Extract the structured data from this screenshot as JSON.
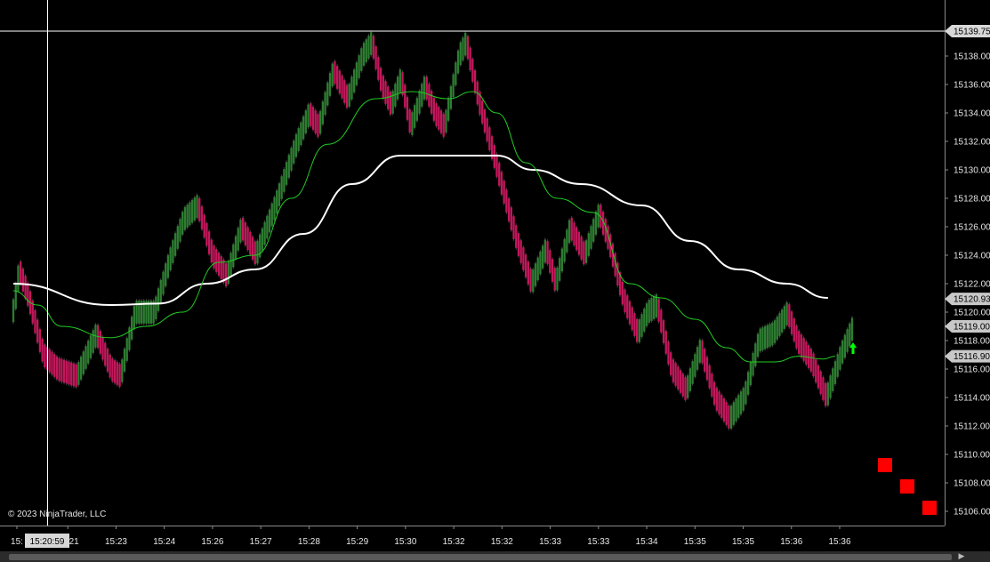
{
  "chart_data": {
    "type": "candlestick",
    "title": "",
    "copyright": "© 2023 NinjaTrader, LLC",
    "crosshair": {
      "time_label": "15:20:59",
      "price": 15139.75,
      "price_label": "15139.75"
    },
    "y_axis": {
      "ylim": [
        15105,
        15141
      ],
      "ticks": [
        {
          "value": 15138,
          "label": "15138.00"
        },
        {
          "value": 15136,
          "label": "15136.00"
        },
        {
          "value": 15134,
          "label": "15134.00"
        },
        {
          "value": 15132,
          "label": "15132.00"
        },
        {
          "value": 15130,
          "label": "15130.00"
        },
        {
          "value": 15128,
          "label": "15128.00"
        },
        {
          "value": 15126,
          "label": "15126.00"
        },
        {
          "value": 15124,
          "label": "15124.00"
        },
        {
          "value": 15122,
          "label": "15122.00"
        },
        {
          "value": 15120,
          "label": "15120.00"
        },
        {
          "value": 15118,
          "label": "15118.00"
        },
        {
          "value": 15116,
          "label": "15116.00"
        },
        {
          "value": 15114,
          "label": "15114.00"
        },
        {
          "value": 15112,
          "label": "15112.00"
        },
        {
          "value": 15110,
          "label": "15110.00"
        },
        {
          "value": 15108,
          "label": "15108.00"
        },
        {
          "value": 15106,
          "label": "15106.00"
        }
      ]
    },
    "x_axis": {
      "ticks": [
        "15:",
        "15:21",
        "15:23",
        "15:24",
        "15:26",
        "15:27",
        "15:28",
        "15:29",
        "15:30",
        "15:32",
        "15:32",
        "15:33",
        "15:33",
        "15:34",
        "15:35",
        "15:35",
        "15:36",
        "15:36"
      ]
    },
    "price_tags": [
      {
        "value": 15120.93,
        "label": "15120.93",
        "color": "#c8c8c8"
      },
      {
        "value": 15119.0,
        "label": "15119.00",
        "color": "#c8c8c8"
      },
      {
        "value": 15116.9,
        "label": "15116.90",
        "color": "#c8c8c8"
      }
    ],
    "key_points": [
      [
        0,
        15120.5
      ],
      [
        2,
        15123.0
      ],
      [
        6,
        15121.0
      ],
      [
        12,
        15117.0
      ],
      [
        18,
        15116.0
      ],
      [
        26,
        15115.5
      ],
      [
        34,
        15118.5
      ],
      [
        40,
        15116.0
      ],
      [
        44,
        15115.5
      ],
      [
        50,
        15120.0
      ],
      [
        58,
        15120.0
      ],
      [
        64,
        15123.5
      ],
      [
        70,
        15126.5
      ],
      [
        76,
        15127.5
      ],
      [
        82,
        15124.0
      ],
      [
        88,
        15122.5
      ],
      [
        94,
        15126.0
      ],
      [
        100,
        15124.0
      ],
      [
        108,
        15127.5
      ],
      [
        116,
        15131.5
      ],
      [
        122,
        15134.0
      ],
      [
        126,
        15133.0
      ],
      [
        132,
        15137.0
      ],
      [
        138,
        15135.0
      ],
      [
        144,
        15138.0
      ],
      [
        148,
        15139.0
      ],
      [
        152,
        15136.0
      ],
      [
        156,
        15134.5
      ],
      [
        160,
        15136.5
      ],
      [
        164,
        15133.0
      ],
      [
        170,
        15136.0
      ],
      [
        174,
        15134.0
      ],
      [
        178,
        15133.0
      ],
      [
        184,
        15138.0
      ],
      [
        187,
        15139.0
      ],
      [
        192,
        15135.0
      ],
      [
        200,
        15130.0
      ],
      [
        208,
        15125.0
      ],
      [
        214,
        15122.0
      ],
      [
        220,
        15124.5
      ],
      [
        224,
        15122.0
      ],
      [
        230,
        15126.0
      ],
      [
        236,
        15124.0
      ],
      [
        242,
        15127.0
      ],
      [
        246,
        15125.0
      ],
      [
        252,
        15121.0
      ],
      [
        258,
        15118.5
      ],
      [
        262,
        15120.0
      ],
      [
        266,
        15120.5
      ],
      [
        272,
        15116.0
      ],
      [
        278,
        15114.5
      ],
      [
        284,
        15117.5
      ],
      [
        290,
        15114.0
      ],
      [
        296,
        15112.5
      ],
      [
        302,
        15114.0
      ],
      [
        308,
        15118.0
      ],
      [
        314,
        15118.5
      ],
      [
        320,
        15120.0
      ],
      [
        324,
        15118.0
      ],
      [
        330,
        15116.5
      ],
      [
        336,
        15114.0
      ],
      [
        342,
        15117.0
      ],
      [
        347,
        15119.0
      ]
    ],
    "bars": {
      "count": 348,
      "box_size": 1.0,
      "up_color": "#2e7d32",
      "down_color": "#c2185b"
    },
    "series": [
      {
        "type": "line",
        "color": "#ffffff",
        "width": 2,
        "x": [
          0,
          40,
          60,
          80,
          100,
          120,
          140,
          160,
          180,
          200,
          215,
          235,
          260,
          280,
          300,
          320,
          337
        ],
        "values": [
          15122.0,
          15120.5,
          15120.6,
          15122.0,
          15123.0,
          15125.5,
          15129.0,
          15131.0,
          15131.0,
          15131.0,
          15130.0,
          15129.0,
          15127.5,
          15125.0,
          15123.0,
          15122.0,
          15121.0
        ]
      },
      {
        "type": "line",
        "color": "#22cc22",
        "width": 1,
        "x": [
          0,
          10,
          20,
          40,
          55,
          70,
          85,
          100,
          115,
          130,
          150,
          165,
          180,
          190,
          200,
          212,
          225,
          240,
          255,
          268,
          282,
          295,
          305,
          315,
          325,
          335,
          340
        ],
        "values": [
          15121.5,
          15120.5,
          15119.0,
          15118.2,
          15119.0,
          15120.0,
          15123.5,
          15124.0,
          15128.0,
          15131.8,
          15135.0,
          15135.5,
          15135.0,
          15135.5,
          15134.0,
          15130.5,
          15128.0,
          15127.0,
          15122.0,
          15121.0,
          15119.5,
          15117.5,
          15116.5,
          15116.5,
          15116.9,
          15116.7,
          15116.9
        ]
      }
    ],
    "markers": [
      {
        "type": "square",
        "color": "#ff0000",
        "price": 15109.25,
        "position": "right-1"
      },
      {
        "type": "square",
        "color": "#ff0000",
        "price": 15107.75,
        "position": "right-2"
      },
      {
        "type": "square",
        "color": "#ff0000",
        "price": 15106.25,
        "position": "right-3"
      },
      {
        "type": "arrow-up",
        "color": "#00ff00",
        "price": 15117.5,
        "position": "last-bar"
      }
    ]
  }
}
